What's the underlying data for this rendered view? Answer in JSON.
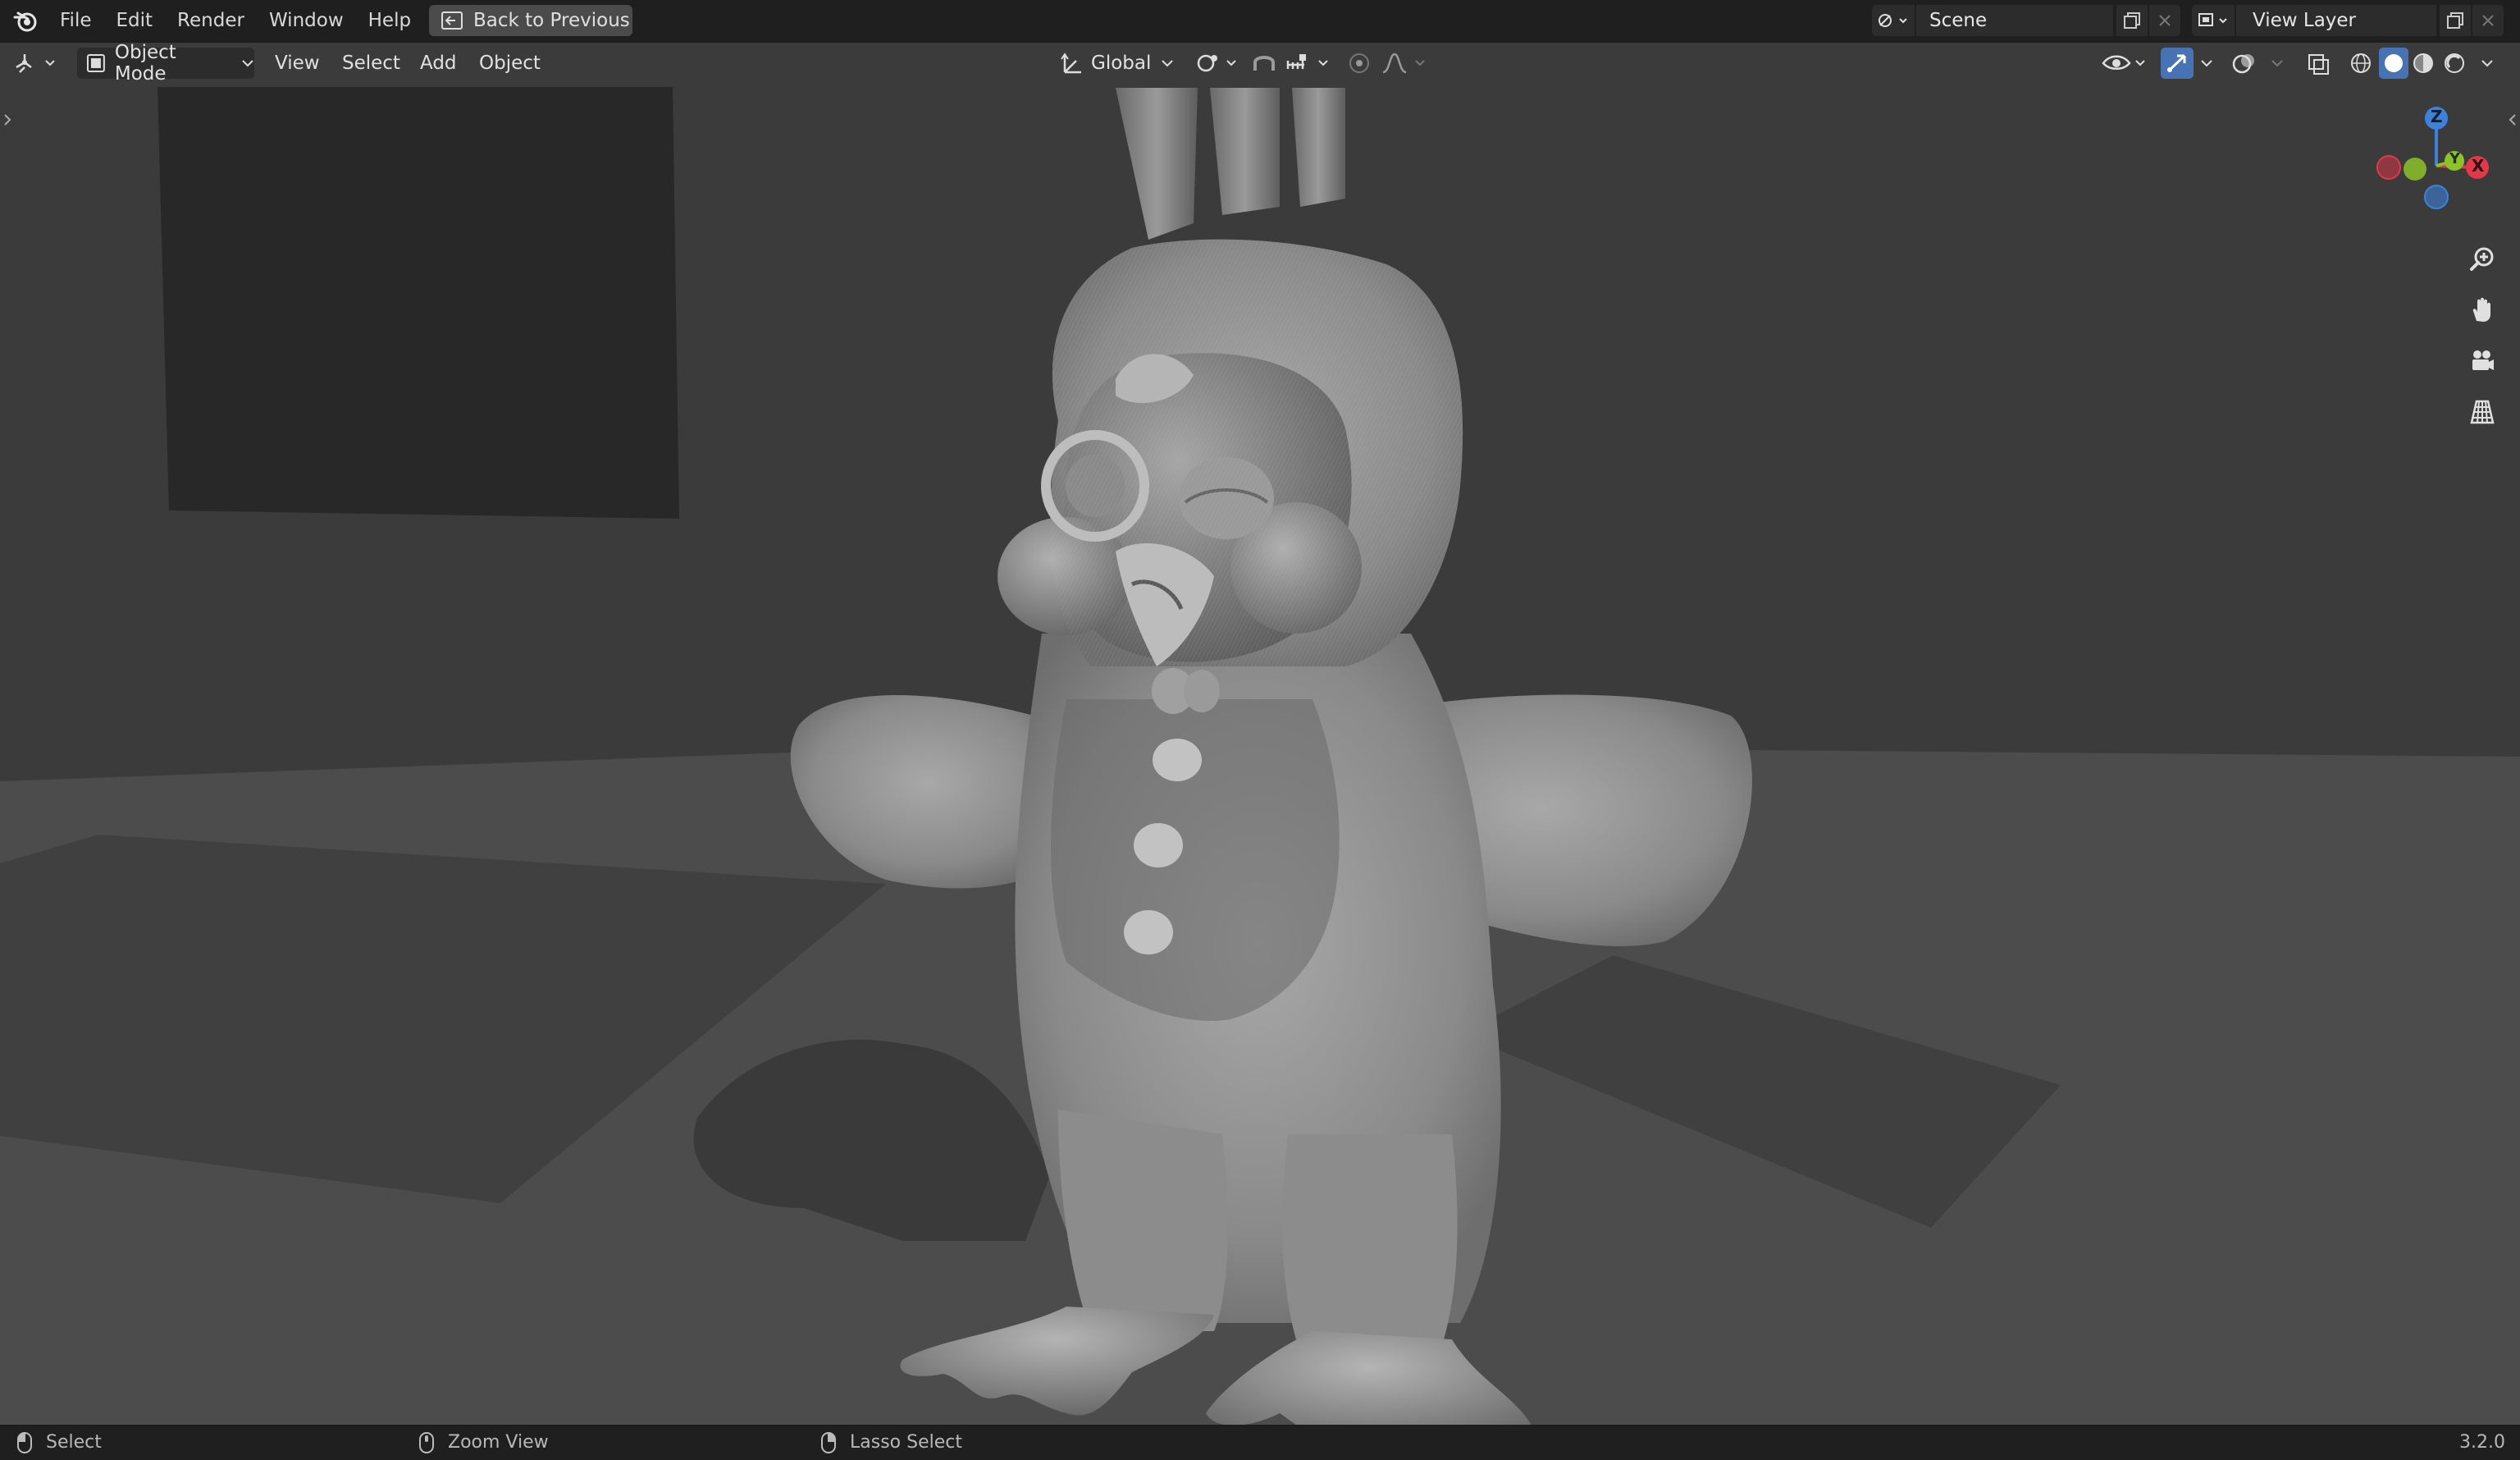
{
  "topbar": {
    "menus": [
      "File",
      "Edit",
      "Render",
      "Window",
      "Help"
    ],
    "back_button": "Back to Previous",
    "scene_name": "Scene",
    "view_layer_name": "View Layer"
  },
  "viewport_header": {
    "mode": "Object Mode",
    "menus": [
      "View",
      "Select",
      "Add",
      "Object"
    ],
    "transform_orientation": "Global"
  },
  "gizmo": {
    "axes": {
      "z": "Z",
      "y": "Y",
      "x": "X"
    },
    "colors": {
      "x": "#e2384a",
      "y": "#8cc32c",
      "z": "#3c82db"
    }
  },
  "navigation": {
    "buttons": [
      "zoom-icon",
      "hand-icon",
      "camera-icon",
      "grid-icon"
    ]
  },
  "statusbar": {
    "left": "Select",
    "middle": "Zoom View",
    "right": "Lasso Select",
    "version": "3.2.0"
  },
  "theme": {
    "accent": "#4772b3",
    "bar_bg": "#1f1f1f"
  }
}
